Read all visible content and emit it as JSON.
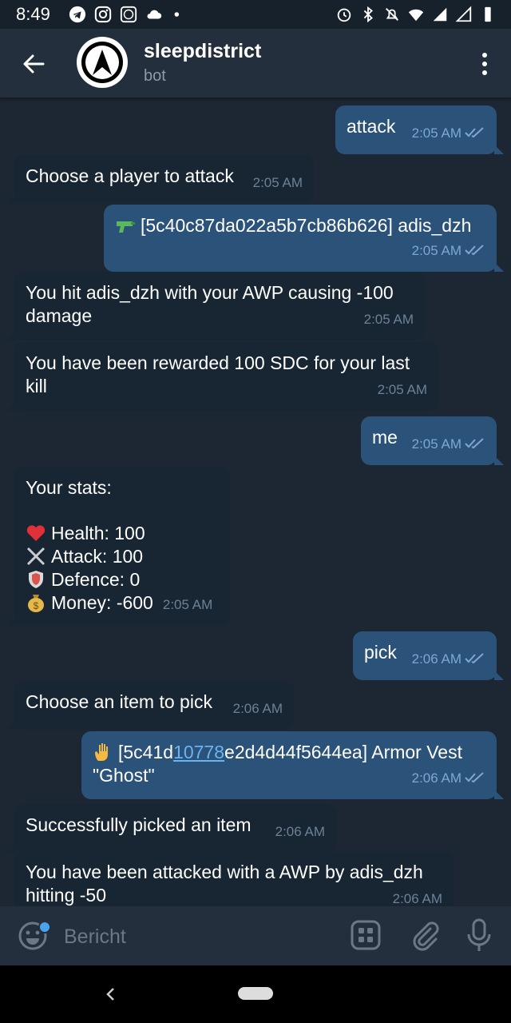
{
  "status": {
    "time": "8:49"
  },
  "header": {
    "title": "sleepdistrict",
    "subtitle": "bot"
  },
  "messages": [
    {
      "id": "m1",
      "text": "attack",
      "time": "2:05 AM"
    },
    {
      "id": "m2",
      "text": "Choose a player to attack",
      "time": "2:05 AM"
    },
    {
      "id": "m3",
      "text": "[5c40c87da022a5b7cb86b626] adis_dzh",
      "time": "2:05 AM",
      "emoji": "pistol"
    },
    {
      "id": "m4",
      "line1": "You hit adis_dzh with your AWP causing -100",
      "line2": "damage",
      "time": "2:05 AM"
    },
    {
      "id": "m5",
      "line1": "You have been rewarded 100 SDC for your last",
      "line2": "kill",
      "time": "2:05 AM"
    },
    {
      "id": "m6",
      "text": "me",
      "time": "2:05 AM"
    },
    {
      "id": "m7",
      "title": "Your stats:",
      "health": "Health: 100",
      "attack": "Attack: 100",
      "defence": "Defence: 0",
      "money": "Money: -600",
      "time": "2:05 AM"
    },
    {
      "id": "m8",
      "text": "pick",
      "time": "2:06 AM"
    },
    {
      "id": "m9",
      "text": "Choose an item to pick",
      "time": "2:06 AM"
    },
    {
      "id": "m10",
      "pre": "[5c41d",
      "link": "10778",
      "post": "e2d4d44f5644ea] Armor Vest",
      "line2": "\"Ghost\"",
      "time": "2:06 AM",
      "emoji": "raised-hand"
    },
    {
      "id": "m11",
      "text": "Successfully picked an item",
      "time": "2:06 AM"
    },
    {
      "id": "m12",
      "line1": "You have been attacked with a AWP by adis_dzh",
      "line2": "hitting -50",
      "time": "2:06 AM"
    }
  ],
  "input": {
    "placeholder": "Bericht"
  },
  "colors": {
    "background": "#1d2733",
    "bubble_in": "#182533",
    "bubble_out": "#2b5278",
    "header": "#242f3d",
    "link": "#6ab3f3"
  }
}
